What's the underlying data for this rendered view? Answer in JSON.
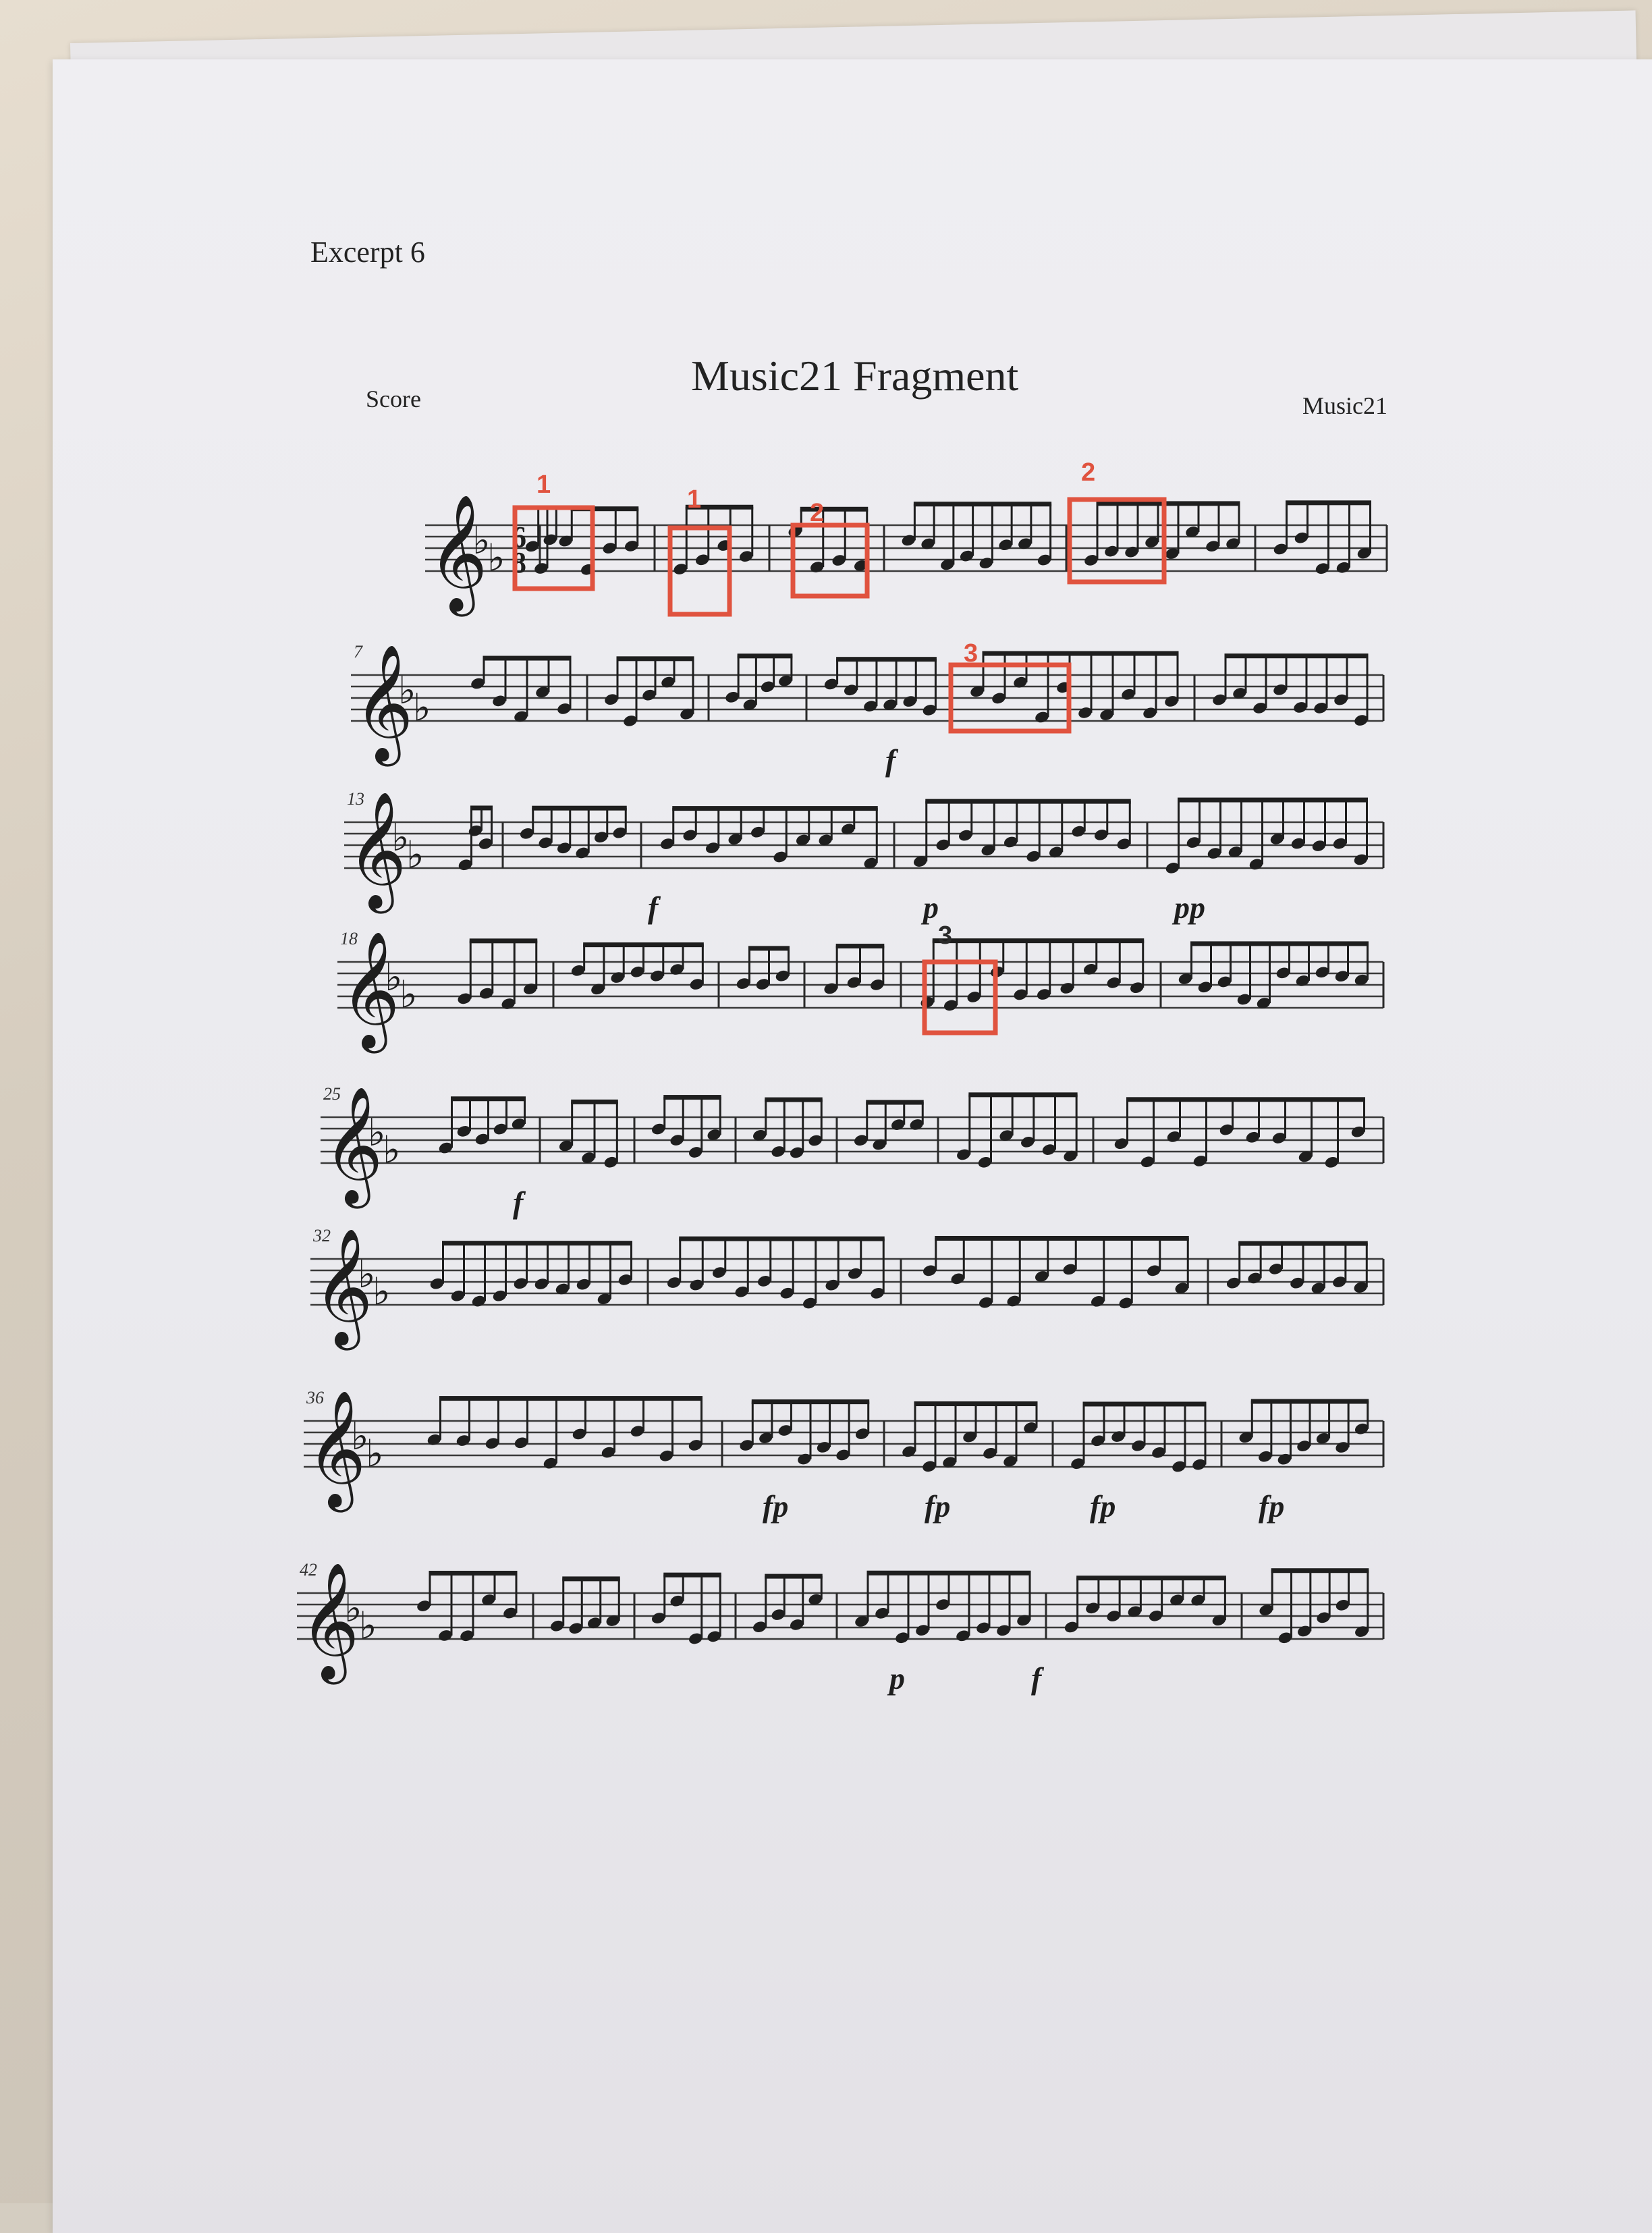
{
  "document": {
    "excerpt_label": "Excerpt 6",
    "score_label": "Score",
    "title": "Music21 Fragment",
    "composer": "Music21"
  },
  "music": {
    "key_signature": "B-flat major (2 flats)",
    "time_signature": "6/8",
    "systems": [
      {
        "start_measure": "",
        "dynamics": []
      },
      {
        "start_measure": "7",
        "dynamics": [
          "f"
        ]
      },
      {
        "start_measure": "13",
        "dynamics": [
          "f",
          "p",
          "pp"
        ]
      },
      {
        "start_measure": "18",
        "dynamics": []
      },
      {
        "start_measure": "25",
        "dynamics": [
          "f"
        ]
      },
      {
        "start_measure": "32",
        "dynamics": []
      },
      {
        "start_measure": "36",
        "dynamics": [
          "fp",
          "fp",
          "fp",
          "fp"
        ]
      },
      {
        "start_measure": "42",
        "dynamics": [
          "p",
          "f"
        ]
      }
    ]
  },
  "annotations": {
    "color": "#e0533f",
    "labels": [
      "1",
      "1",
      "2",
      "2",
      "3",
      "3"
    ]
  }
}
